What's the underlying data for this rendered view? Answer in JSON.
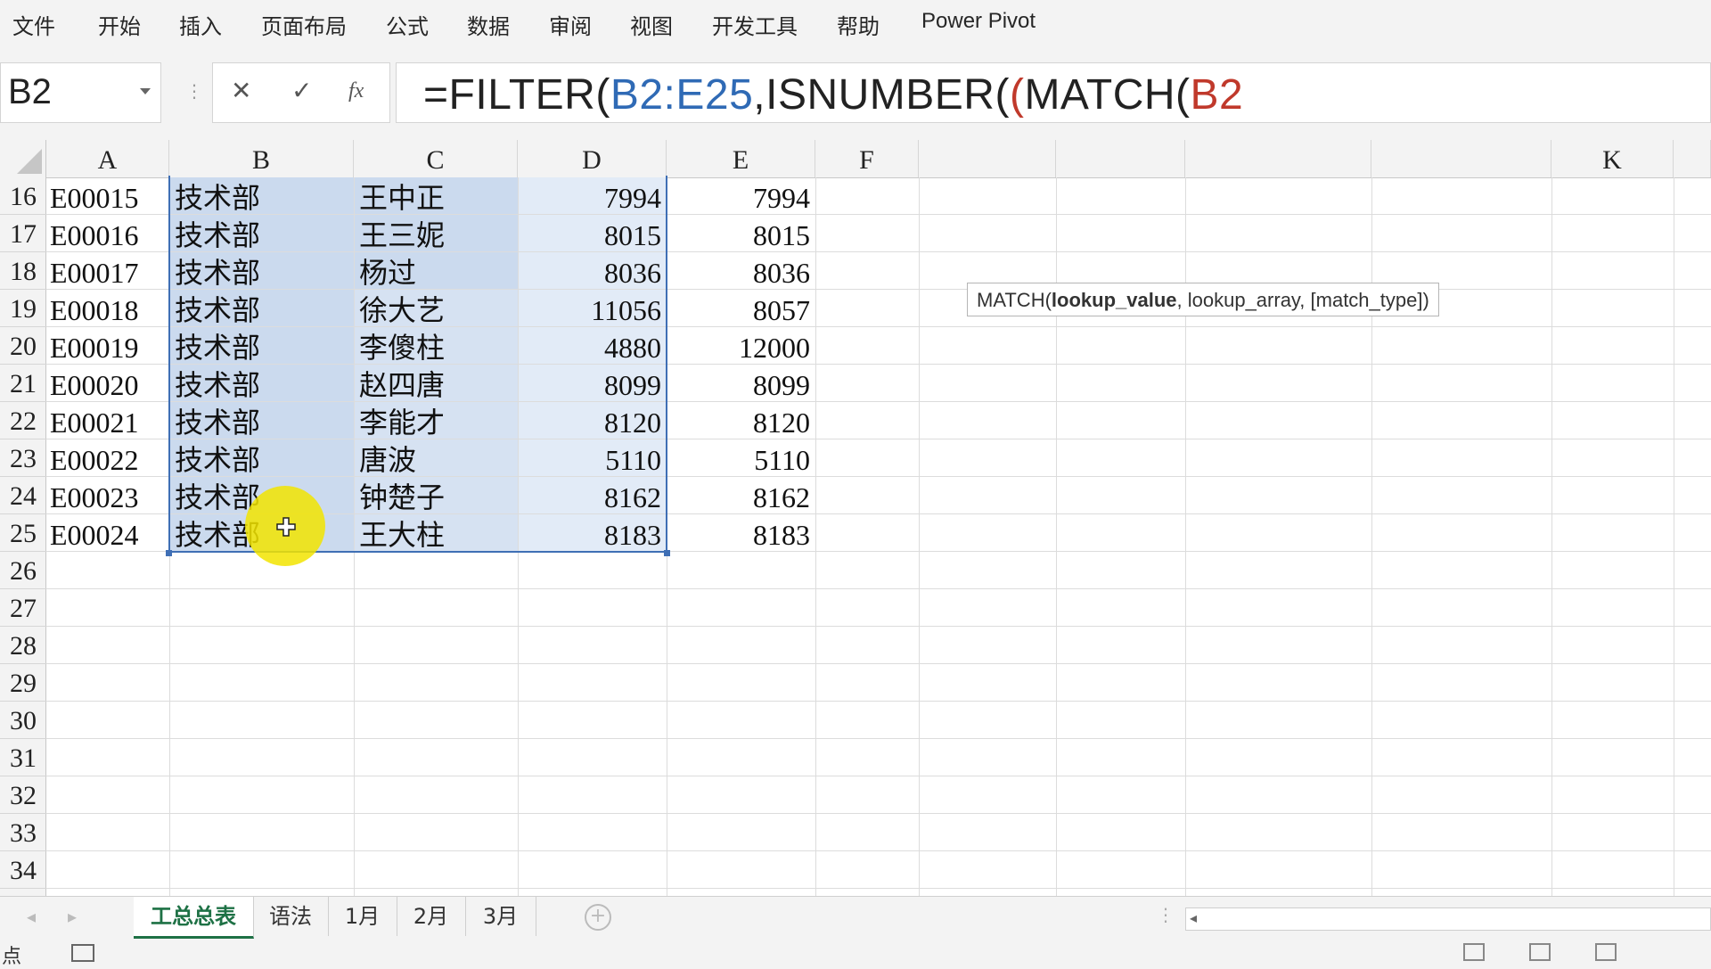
{
  "menu": {
    "items": [
      "文件",
      "开始",
      "插入",
      "页面布局",
      "公式",
      "数据",
      "审阅",
      "视图",
      "开发工具",
      "帮助",
      "Power Pivot"
    ]
  },
  "formula_bar": {
    "name_box": "B2",
    "cancel_icon": "✕",
    "enter_icon": "✓",
    "fx_label": "fx",
    "formula_parts": [
      {
        "text": "=FILTER(",
        "color": "#222222"
      },
      {
        "text": "B2:E25",
        "color": "#2f6ab5"
      },
      {
        "text": ",ISNUMBER(",
        "color": "#222222"
      },
      {
        "text": "(",
        "color": "#c0392b"
      },
      {
        "text": "MATCH(",
        "color": "#222222"
      },
      {
        "text": "B2",
        "color": "#c0392b"
      }
    ]
  },
  "columns": [
    "A",
    "B",
    "C",
    "D",
    "E",
    "F",
    "",
    "",
    "",
    "",
    "K"
  ],
  "rows": [
    {
      "num": "16",
      "a": "E00015",
      "b": "技术部",
      "c": "王中正",
      "d": "7994",
      "e": "7994"
    },
    {
      "num": "17",
      "a": "E00016",
      "b": "技术部",
      "c": "王三妮",
      "d": "8015",
      "e": "8015"
    },
    {
      "num": "18",
      "a": "E00017",
      "b": "技术部",
      "c": "杨过",
      "d": "8036",
      "e": "8036"
    },
    {
      "num": "19",
      "a": "E00018",
      "b": "技术部",
      "c": "徐大艺",
      "d": "11056",
      "e": "8057"
    },
    {
      "num": "20",
      "a": "E00019",
      "b": "技术部",
      "c": "李傻柱",
      "d": "4880",
      "e": "12000"
    },
    {
      "num": "21",
      "a": "E00020",
      "b": "技术部",
      "c": "赵四唐",
      "d": "8099",
      "e": "8099"
    },
    {
      "num": "22",
      "a": "E00021",
      "b": "技术部",
      "c": "李能才",
      "d": "8120",
      "e": "8120"
    },
    {
      "num": "23",
      "a": "E00022",
      "b": "技术部",
      "c": "唐波",
      "d": "5110",
      "e": "5110"
    },
    {
      "num": "24",
      "a": "E00023",
      "b": "技术部",
      "c": "钟楚子",
      "d": "8162",
      "e": "8162"
    },
    {
      "num": "25",
      "a": "E00024",
      "b": "技术部",
      "c": "王大柱",
      "d": "8183",
      "e": "8183"
    },
    {
      "num": "26"
    },
    {
      "num": "27"
    },
    {
      "num": "28"
    },
    {
      "num": "29"
    },
    {
      "num": "30"
    },
    {
      "num": "31"
    },
    {
      "num": "32"
    },
    {
      "num": "33"
    },
    {
      "num": "34"
    }
  ],
  "tooltip": {
    "func": "MATCH(",
    "bold_arg": "lookup_value",
    "rest": ", lookup_array, [match_type])"
  },
  "sheet_tabs": [
    "工总总表",
    "语法",
    "1月",
    "2月",
    "3月"
  ],
  "active_tab": "工总总表",
  "tab_add_icon": "+",
  "status": {
    "mode": "点"
  },
  "colors": {
    "accent_green": "#1e7145",
    "selection_blue": "#3f6fb5",
    "cursor_yellow": "#f2e400"
  }
}
